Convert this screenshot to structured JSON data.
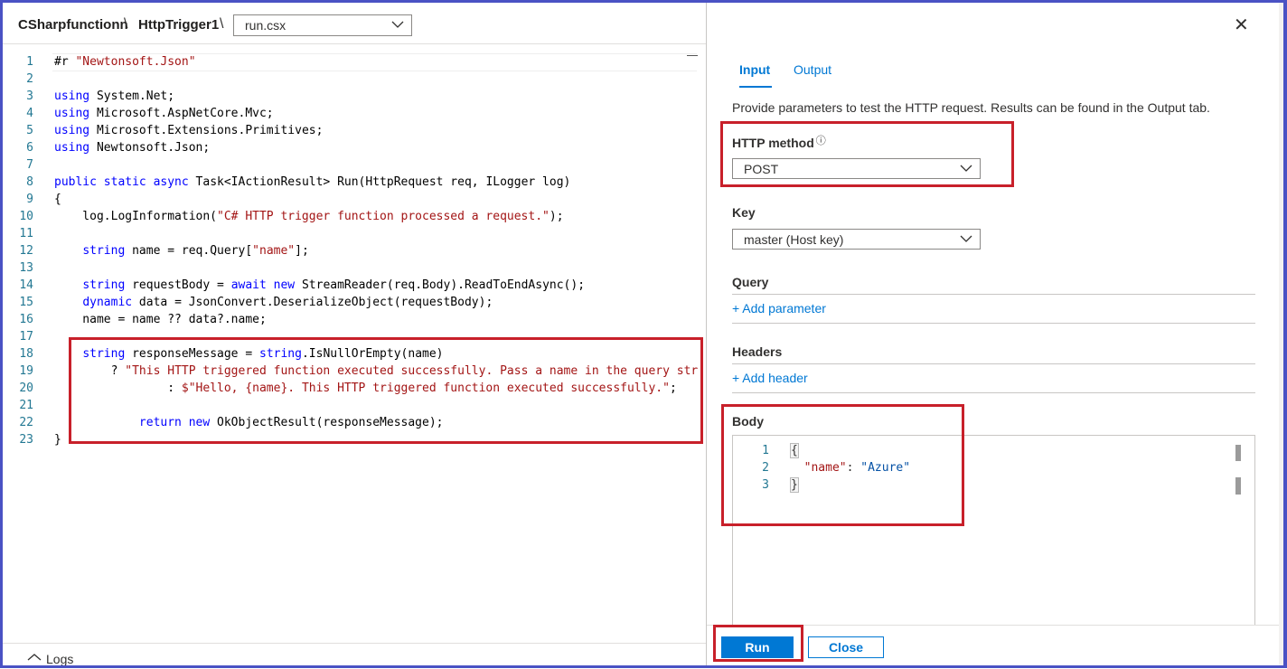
{
  "breadcrumb": {
    "function_app": "CSharpfunctionn",
    "separator": "\\",
    "function": "HttpTrigger1",
    "file": "run.csx"
  },
  "editor": {
    "lines": [
      {
        "n": "1"
      },
      {
        "n": "2"
      },
      {
        "n": "3"
      },
      {
        "n": "4"
      },
      {
        "n": "5"
      },
      {
        "n": "6"
      },
      {
        "n": "7"
      },
      {
        "n": "8"
      },
      {
        "n": "9"
      },
      {
        "n": "10"
      },
      {
        "n": "11"
      },
      {
        "n": "12"
      },
      {
        "n": "13"
      },
      {
        "n": "14"
      },
      {
        "n": "15"
      },
      {
        "n": "16"
      },
      {
        "n": "17"
      },
      {
        "n": "18"
      },
      {
        "n": "19"
      },
      {
        "n": "20"
      },
      {
        "n": "21"
      },
      {
        "n": "22"
      },
      {
        "n": "23"
      }
    ],
    "code": {
      "l1a": "#r ",
      "l1b": "\"Newtonsoft.Json\"",
      "l3a": "using",
      "l3b": " System.Net;",
      "l4a": "using",
      "l4b": " Microsoft.AspNetCore.Mvc;",
      "l5a": "using",
      "l5b": " Microsoft.Extensions.Primitives;",
      "l6a": "using",
      "l6b": " Newtonsoft.Json;",
      "l8a": "public static async",
      "l8b": " Task<IActionResult> Run(HttpRequest req, ILogger log)",
      "l9": "{",
      "l10a": "    log.LogInformation(",
      "l10b": "\"C# HTTP trigger function processed a request.\"",
      "l10c": ");",
      "l12a": "    ",
      "l12b": "string",
      "l12c": " name = req.Query[",
      "l12d": "\"name\"",
      "l12e": "];",
      "l14a": "    ",
      "l14b": "string",
      "l14c": " requestBody = ",
      "l14d": "await new",
      "l14e": " StreamReader(req.Body).ReadToEndAsync();",
      "l15a": "    ",
      "l15b": "dynamic",
      "l15c": " data = JsonConvert.DeserializeObject(requestBody);",
      "l16": "    name = name ?? data?.name;",
      "l18a": "    ",
      "l18b": "string",
      "l18c": " responseMessage = ",
      "l18d": "string",
      "l18e": ".IsNullOrEmpty(name)",
      "l19a": "        ? ",
      "l19b": "\"This HTTP triggered function executed successfully. Pass a name in the query strin",
      "l20a": "                : ",
      "l20b": "$\"Hello, {name}. This HTTP triggered function executed successfully.\"",
      "l20c": ";",
      "l22a": "            ",
      "l22b": "return new",
      "l22c": " OkObjectResult(responseMessage);",
      "l23": "}"
    }
  },
  "logs": {
    "label": "Logs"
  },
  "test_panel": {
    "tabs": {
      "input": "Input",
      "output": "Output"
    },
    "description": "Provide parameters to test the HTTP request. Results can be found in the Output tab.",
    "http_method": {
      "label": "HTTP method",
      "info_icon": "ⓘ",
      "value": "POST"
    },
    "key": {
      "label": "Key",
      "value": "master (Host key)"
    },
    "query": {
      "label": "Query",
      "add": "+ Add parameter"
    },
    "headers": {
      "label": "Headers",
      "add": "+ Add header"
    },
    "body": {
      "label": "Body",
      "line_numbers": [
        "1",
        "2",
        "3"
      ],
      "open_brace": "{",
      "key": "\"name\"",
      "colon": ": ",
      "value": "\"Azure\"",
      "close_brace": "}"
    },
    "buttons": {
      "run": "Run",
      "close": "Close"
    }
  },
  "colors": {
    "accent": "#0078d4",
    "highlight": "#c8202a",
    "keyword": "#0000ff",
    "string": "#a31515"
  }
}
